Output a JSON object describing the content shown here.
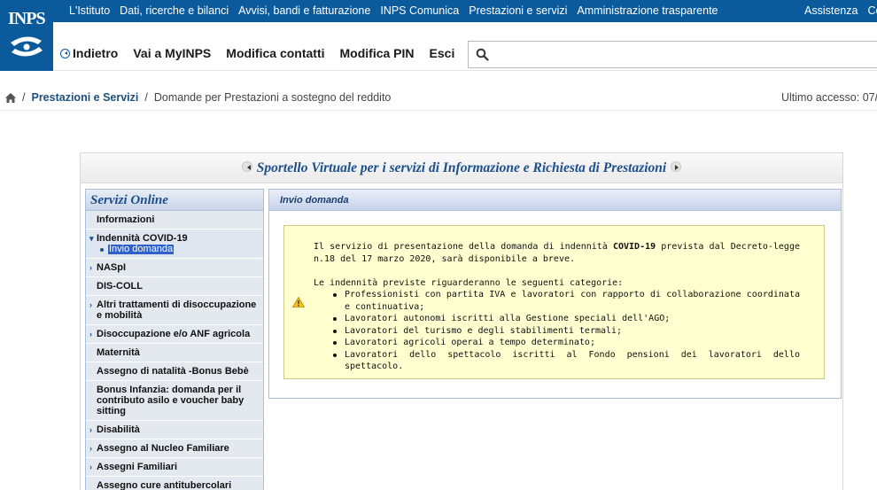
{
  "header": {
    "logo_text": "INPS",
    "top_nav": [
      "L'Istituto",
      "Dati, ricerche e bilanci",
      "Avvisi, bandi e fatturazione",
      "INPS Comunica",
      "Prestazioni e servizi",
      "Amministrazione trasparente"
    ],
    "top_right": [
      "Assistenza",
      "Co"
    ],
    "main_nav": {
      "back": "Indietro",
      "myinps": "Vai a MyINPS",
      "contacts": "Modifica contatti",
      "pin": "Modifica PIN",
      "logout": "Esci"
    },
    "search_icon": "search-icon"
  },
  "breadcrumb": {
    "home_icon": "home-icon",
    "items": [
      "Prestazioni e Servizi",
      "Domande per Prestazioni a sostegno del reddito"
    ],
    "separator": "/",
    "last_access": "Ultimo accesso: 07/0"
  },
  "sportello": {
    "title": "Sportello Virtuale per i servizi di Informazione e Richiesta di Prestazioni"
  },
  "menu": {
    "title": "Servizi Online",
    "items": [
      {
        "label": "Informazioni",
        "caret": ""
      },
      {
        "label": "Indennità COVID-19",
        "caret": "▾",
        "sub": "Invio domanda"
      },
      {
        "label": "NASpI",
        "caret": "›"
      },
      {
        "label": "DIS-COLL",
        "caret": ""
      },
      {
        "label": "Altri trattamenti di disoccupazione e mobilità",
        "caret": "›"
      },
      {
        "label": "Disoccupazione e/o ANF agricola",
        "caret": "›"
      },
      {
        "label": "Maternità",
        "caret": ""
      },
      {
        "label": "Assegno di natalità -Bonus Bebè",
        "caret": ""
      },
      {
        "label": "Bonus Infanzia: domanda per il contributo asilo e voucher baby sitting",
        "caret": ""
      },
      {
        "label": "Disabilità",
        "caret": "›"
      },
      {
        "label": "Assegno al Nucleo Familiare",
        "caret": "›"
      },
      {
        "label": "Assegni Familiari",
        "caret": "›"
      },
      {
        "label": "Assegno cure antitubercolari",
        "caret": ""
      }
    ]
  },
  "panel": {
    "title": "Invio domanda",
    "warning_icon": "warning-icon",
    "intro_pre": "Il servizio di presentazione della domanda di indennità ",
    "intro_bold": "COVID-19",
    "intro_post": " prevista dal Decreto-legge n.18 del 17 marzo 2020, sarà disponibile a breve.",
    "list_intro": "Le indennità previste riguarderanno le seguenti categorie:",
    "categories": [
      "Professionisti con partita IVA e lavoratori con rapporto di collaborazione coordinata e continuativa;",
      "Lavoratori autonomi iscritti alla Gestione speciali dell'AGO;",
      "Lavoratori del turismo e degli stabilimenti termali;",
      "Lavoratori agricoli operai a tempo determinato;",
      "Lavoratori dello spettacolo iscritti al Fondo pensioni dei lavoratori dello spettacolo."
    ]
  }
}
